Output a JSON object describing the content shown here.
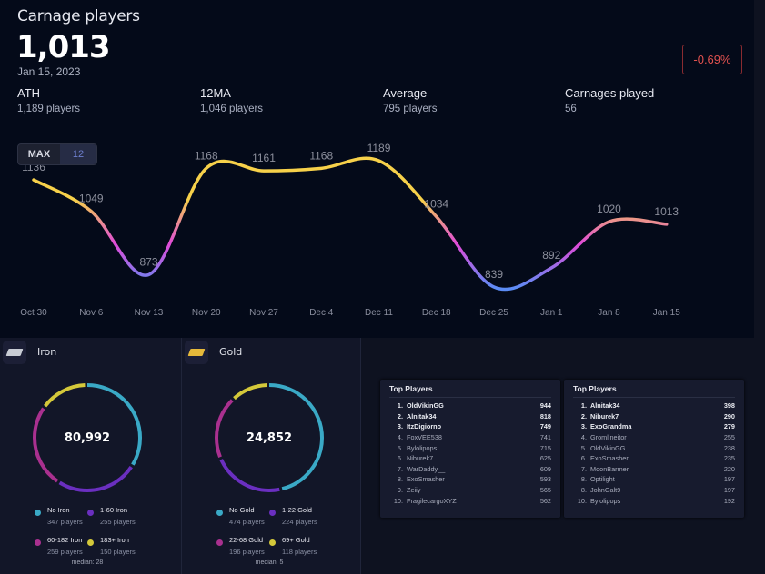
{
  "header": {
    "title": "Carnage players",
    "current": "1,013",
    "date": "Jan 15, 2023",
    "change": "-0.69%"
  },
  "stats": [
    {
      "label": "ATH",
      "value": "1,189 players"
    },
    {
      "label": "12MA",
      "value": "1,046 players"
    },
    {
      "label": "Average",
      "value": "795 players"
    },
    {
      "label": "Carnages played",
      "value": "56"
    }
  ],
  "range": {
    "max": "MAX",
    "n": "12"
  },
  "chart_data": {
    "type": "line",
    "x": [
      "Oct 30",
      "Nov 6",
      "Nov 13",
      "Nov 20",
      "Nov 27",
      "Dec 4",
      "Dec 11",
      "Dec 18",
      "Dec 25",
      "Jan 1",
      "Jan 8",
      "Jan 15"
    ],
    "values": [
      1136,
      1049,
      873,
      1168,
      1161,
      1168,
      1189,
      1034,
      839,
      892,
      1020,
      1013
    ],
    "labels": [
      "1136",
      "1049",
      "873",
      "1168",
      "1161",
      "1168",
      "1189",
      "1034",
      "839",
      "892",
      "1020",
      "1013"
    ],
    "gradient": [
      "#f7d14a",
      "#e04bd8",
      "#5b8cf5"
    ],
    "grid": false
  },
  "resources": [
    {
      "name": "Iron",
      "total": "80,992",
      "median": "median: 28",
      "segments": [
        {
          "label": "No Iron",
          "players": "347 players",
          "value": 347,
          "color": "#3aa9c6"
        },
        {
          "label": "1-60 Iron",
          "players": "255 players",
          "value": 255,
          "color": "#6a2fc0"
        },
        {
          "label": "60-182 Iron",
          "players": "259 players",
          "value": 259,
          "color": "#a9308f"
        },
        {
          "label": "183+ Iron",
          "players": "150 players",
          "value": 150,
          "color": "#d4c83a"
        }
      ]
    },
    {
      "name": "Gold",
      "total": "24,852",
      "median": "median: 5",
      "segments": [
        {
          "label": "No Gold",
          "players": "474 players",
          "value": 474,
          "color": "#3aa9c6"
        },
        {
          "label": "1-22 Gold",
          "players": "224 players",
          "value": 224,
          "color": "#6a2fc0"
        },
        {
          "label": "22-68 Gold",
          "players": "196 players",
          "value": 196,
          "color": "#a9308f"
        },
        {
          "label": "69+ Gold",
          "players": "118 players",
          "value": 118,
          "color": "#d4c83a"
        }
      ]
    }
  ],
  "tables": [
    {
      "title": "Top Players",
      "rows": [
        [
          "1.",
          "OldVikinGG",
          "944"
        ],
        [
          "2.",
          "Alnitak34",
          "818"
        ],
        [
          "3.",
          "ItzDigiorno",
          "749"
        ],
        [
          "4.",
          "FoxVEE538",
          "741"
        ],
        [
          "5.",
          "Bylolipops",
          "715"
        ],
        [
          "6.",
          "Niburek7",
          "625"
        ],
        [
          "7.",
          "WarDaddy__",
          "609"
        ],
        [
          "8.",
          "ExoSmasher",
          "593"
        ],
        [
          "9.",
          "Zeiiy",
          "565"
        ],
        [
          "10.",
          "FragilecargoXYZ",
          "562"
        ]
      ]
    },
    {
      "title": "Top Players",
      "rows": [
        [
          "1.",
          "Alnitak34",
          "398"
        ],
        [
          "2.",
          "Niburek7",
          "290"
        ],
        [
          "3.",
          "ExoGrandma",
          "279"
        ],
        [
          "4.",
          "Gromlineitor",
          "255"
        ],
        [
          "5.",
          "OldVikinGG",
          "238"
        ],
        [
          "6.",
          "ExoSmasher",
          "235"
        ],
        [
          "7.",
          "MoonBarmer",
          "220"
        ],
        [
          "8.",
          "Optilight",
          "197"
        ],
        [
          "8.",
          "JohnGalt9",
          "197"
        ],
        [
          "10.",
          "Bylolipops",
          "192"
        ]
      ]
    }
  ]
}
